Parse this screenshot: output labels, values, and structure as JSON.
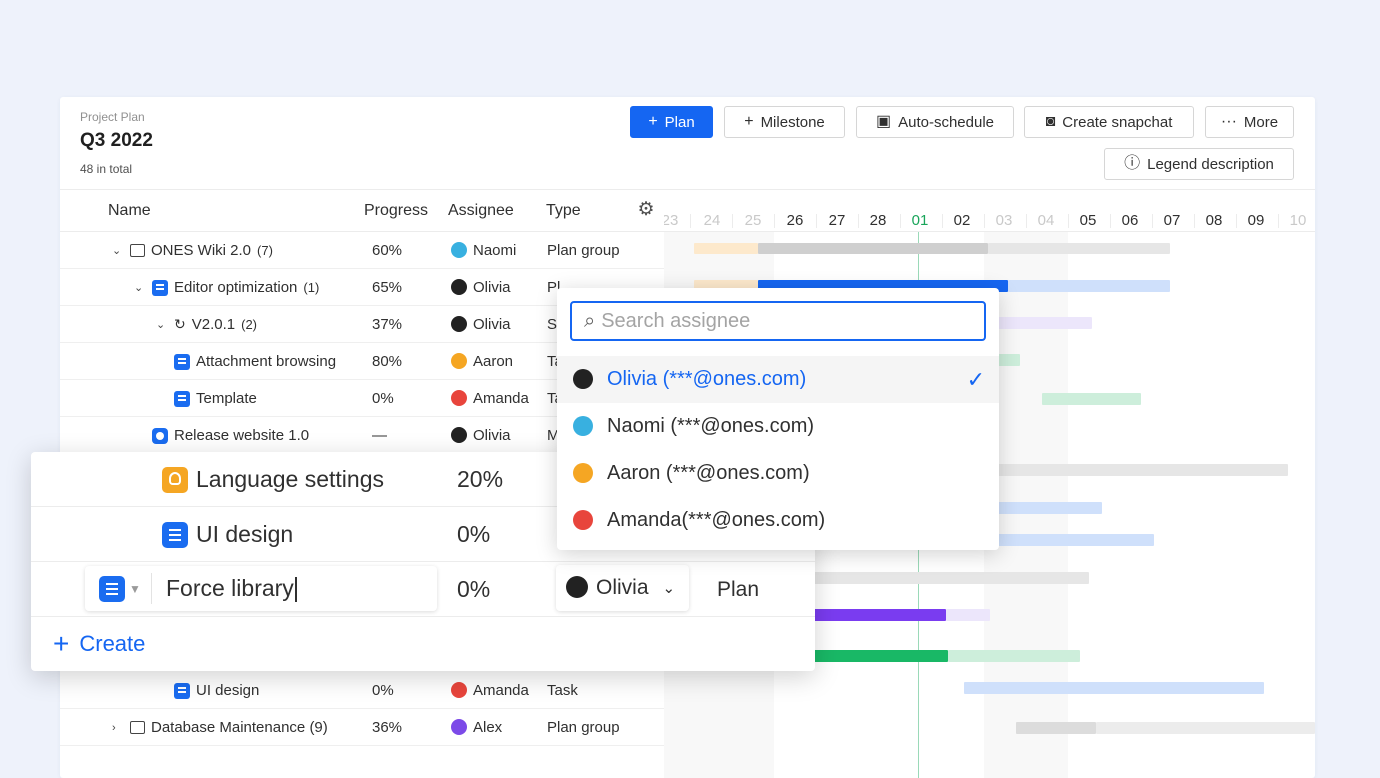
{
  "header": {
    "breadcrumb": "Project Plan",
    "title": "Q3 2022",
    "count": "48 in total"
  },
  "toolbar": {
    "plan": "Plan",
    "milestone": "Milestone",
    "auto_schedule": "Auto-schedule",
    "snapshot": "Create snapchat",
    "more": "More",
    "legend": "Legend description"
  },
  "columns": {
    "name": "Name",
    "progress": "Progress",
    "assignee": "Assignee",
    "type": "Type"
  },
  "rows": [
    {
      "name": "ONES Wiki 2.0",
      "count": "(7)",
      "progress": "60%",
      "assignee": "Naomi",
      "type": "Plan group"
    },
    {
      "name": "Editor optimization",
      "count": "(1)",
      "progress": "65%",
      "assignee": "Olivia",
      "type": "Pl"
    },
    {
      "name": "V2.0.1",
      "count": "(2)",
      "progress": "37%",
      "assignee": "Olivia",
      "type": "S"
    },
    {
      "name": "Attachment browsing",
      "count": "",
      "progress": "80%",
      "assignee": "Aaron",
      "type": "Ta"
    },
    {
      "name": "Template",
      "count": "",
      "progress": "0%",
      "assignee": "Amanda",
      "type": "Ta"
    },
    {
      "name": "Release website 1.0",
      "count": "",
      "progress": "—",
      "assignee": "Olivia",
      "type": "M"
    },
    {
      "name": "UI design",
      "count": "",
      "progress": "0%",
      "assignee": "Amanda",
      "type": "Task"
    },
    {
      "name": "Database Maintenance (9)",
      "count": "",
      "progress": "36%",
      "assignee": "Alex",
      "type": "Plan group"
    }
  ],
  "timeline": {
    "days": [
      "23",
      "24",
      "25",
      "26",
      "27",
      "28",
      "01",
      "02",
      "03",
      "04",
      "05",
      "06",
      "07",
      "08",
      "09",
      "10"
    ],
    "today": "01"
  },
  "popup": {
    "rows": [
      {
        "name": "Language settings",
        "progress": "20%"
      },
      {
        "name": "UI design",
        "progress": "0%"
      }
    ],
    "edit": {
      "value": "Force library",
      "progress": "0%",
      "assignee": "Olivia",
      "type": "Plan"
    },
    "create": "Create"
  },
  "assignee_dropdown": {
    "placeholder": "Search assignee",
    "options": [
      {
        "label": "Olivia (***@ones.com)",
        "selected": true
      },
      {
        "label": "Naomi (***@ones.com)",
        "selected": false
      },
      {
        "label": "Aaron (***@ones.com)",
        "selected": false
      },
      {
        "label": "Amanda(***@ones.com)",
        "selected": false
      }
    ]
  },
  "colors": {
    "accent": "#1566f2",
    "milestone_line": "#9ad9b8"
  },
  "icons": [
    "plus-icon",
    "flag-plus-icon",
    "calendar-icon",
    "camera-icon",
    "more-icon",
    "info-icon",
    "gear-icon",
    "folder-icon",
    "task-icon",
    "release-icon",
    "bulb-icon",
    "search-icon",
    "check-icon",
    "chevron-down-icon"
  ]
}
